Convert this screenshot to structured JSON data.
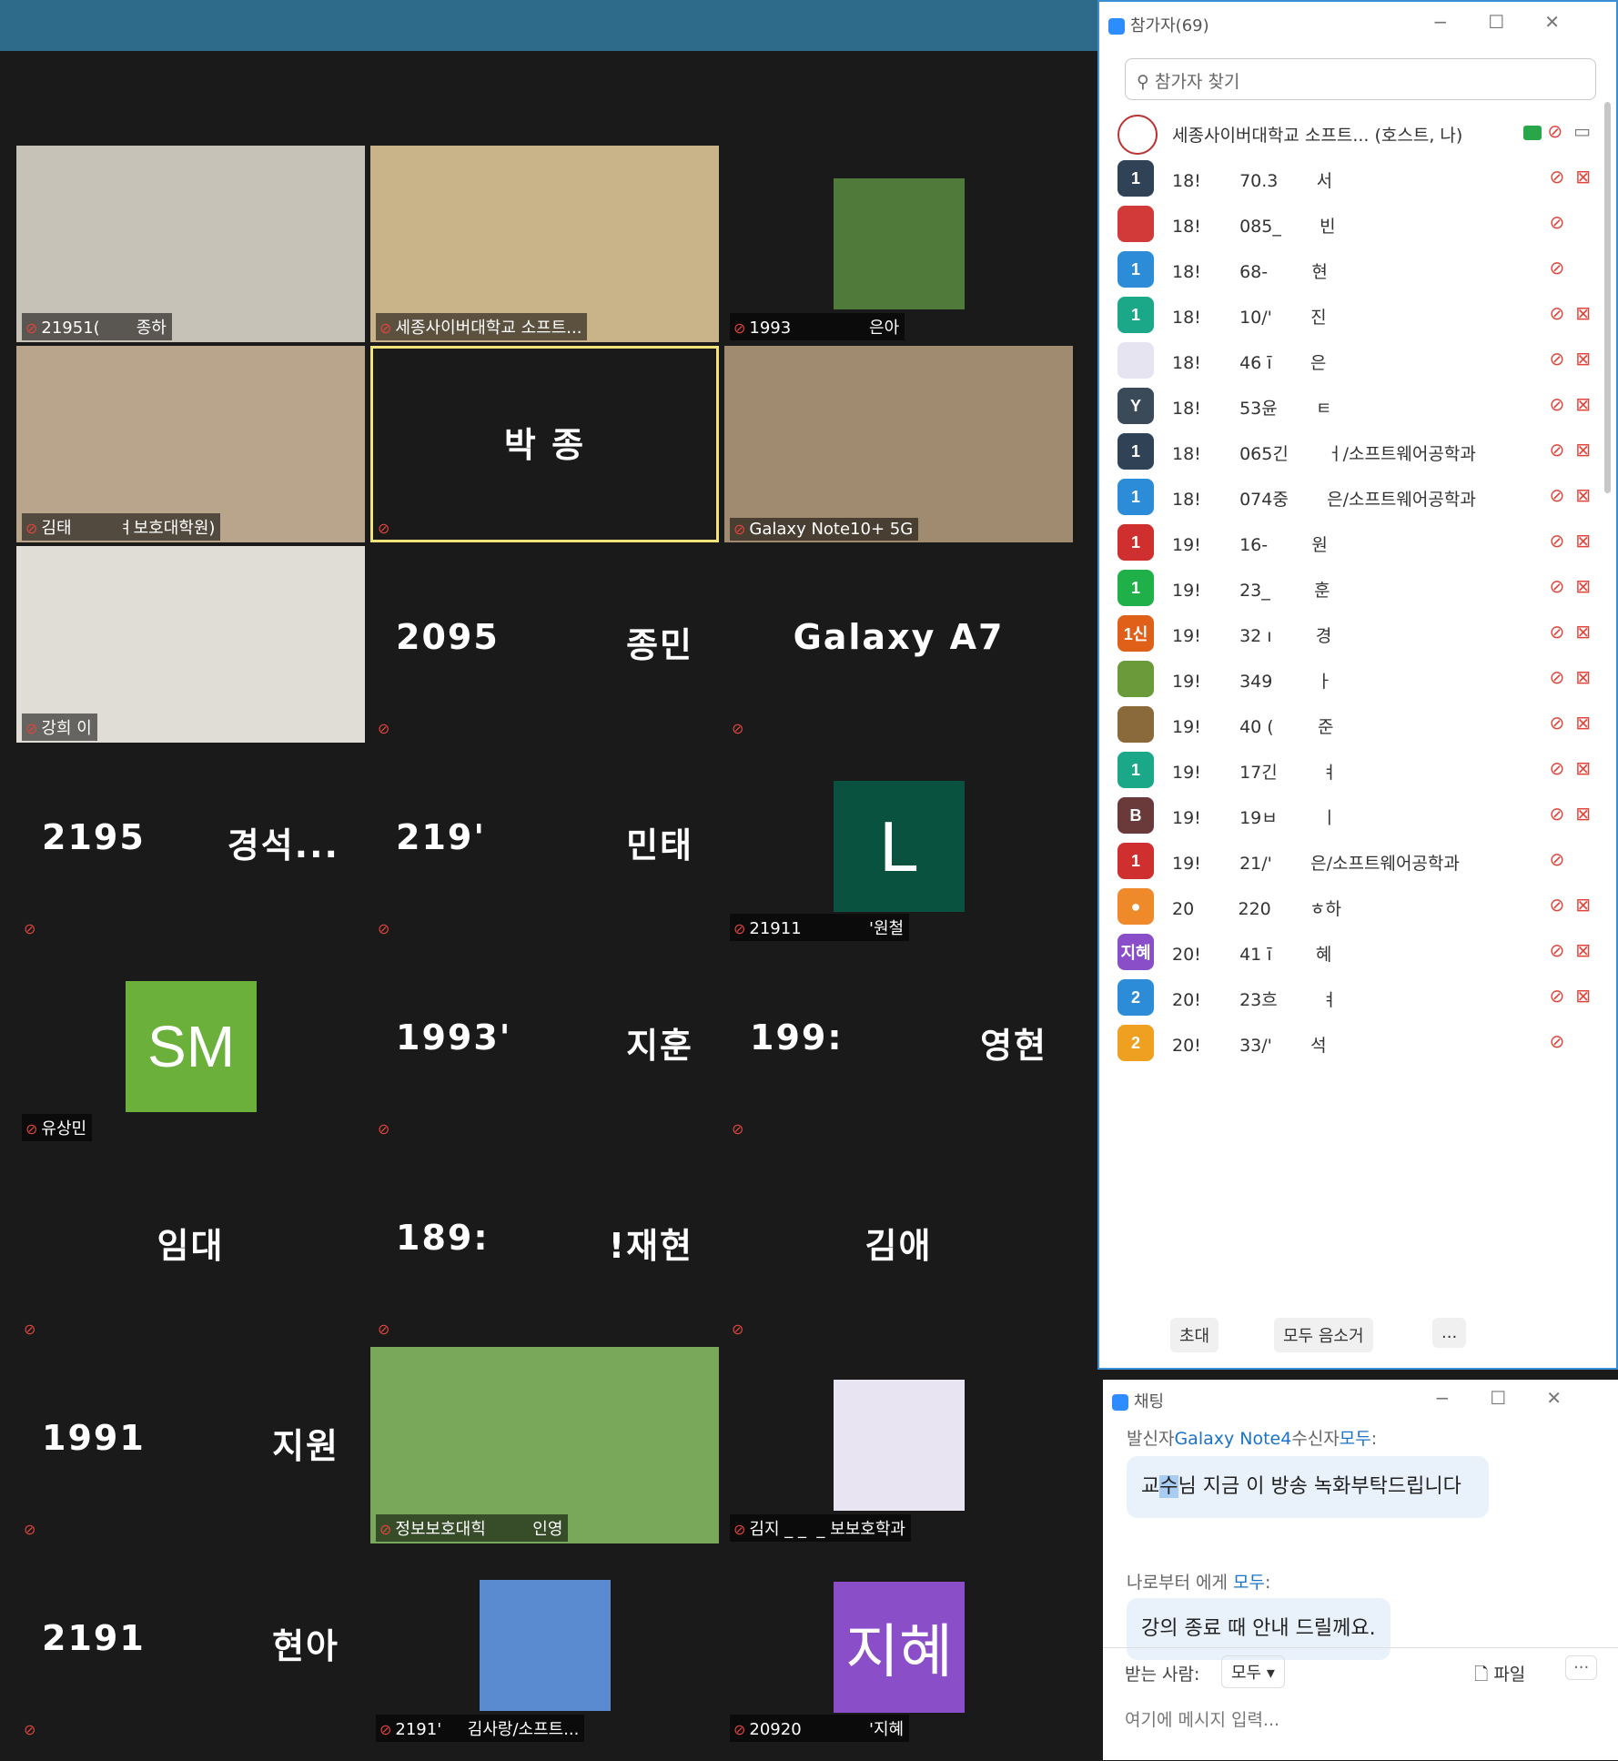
{
  "participants_window": {
    "title": "참가자(69)",
    "search_placeholder": "참가자 찾기",
    "host_row": "세종사이버대학교 소프트... (호스트, 나)",
    "rows": [
      {
        "avatar": "1",
        "avatar_color": "#2f4256",
        "text": "18!       70.3       서",
        "cam": true
      },
      {
        "avatar": "",
        "avatar_color": "#d23a3a",
        "text": "18!       085_       빈",
        "cam": false
      },
      {
        "avatar": "1",
        "avatar_color": "#2d8cd8",
        "text": "18!       68-        현",
        "cam": false
      },
      {
        "avatar": "1",
        "avatar_color": "#1ba888",
        "text": "18!       10/'       진",
        "cam": true
      },
      {
        "avatar": "",
        "avatar_color": "#e7e4f2",
        "text": "18!       46 ī       은",
        "cam": true
      },
      {
        "avatar": "Y",
        "avatar_color": "#3b4a58",
        "text": "18!       53윤       ㅌ",
        "cam": true
      },
      {
        "avatar": "1",
        "avatar_color": "#2f4256",
        "text": "18!       065긴       ㅓ/소프트웨어공학과",
        "cam": true
      },
      {
        "avatar": "1",
        "avatar_color": "#2d8cd8",
        "text": "18!       074중       은/소프트웨어공학과",
        "cam": true
      },
      {
        "avatar": "1",
        "avatar_color": "#cf2f2f",
        "text": "19!       16-        원",
        "cam": true
      },
      {
        "avatar": "1",
        "avatar_color": "#1fb04a",
        "text": "19!       23_        훈",
        "cam": true
      },
      {
        "avatar": "1신",
        "avatar_color": "#e0601a",
        "text": "19!       32 ı        경",
        "cam": true
      },
      {
        "avatar": "",
        "avatar_color": "#6a9a3a",
        "text": "19!       349        ㅏ",
        "cam": true
      },
      {
        "avatar": "",
        "avatar_color": "#8a6a3a",
        "text": "19!       40 (        준",
        "cam": true
      },
      {
        "avatar": "1",
        "avatar_color": "#1ba888",
        "text": "19!       17긴        ㅕ",
        "cam": true
      },
      {
        "avatar": "B",
        "avatar_color": "#6a3a3a",
        "text": "19!       19ㅂ        ㅣ",
        "cam": true
      },
      {
        "avatar": "1",
        "avatar_color": "#cf2f2f",
        "text": "19!       21/'       은/소프트웨어공학과",
        "cam": false
      },
      {
        "avatar": "●",
        "avatar_color": "#ef8a2a",
        "text": "20        220       ㅎ하",
        "cam": true
      },
      {
        "avatar": "지혜",
        "avatar_color": "#8a4fc8",
        "text": "20!       41 ī        혜",
        "cam": true
      },
      {
        "avatar": "2",
        "avatar_color": "#2d8cd8",
        "text": "20!       23흐        ㅕ",
        "cam": true
      },
      {
        "avatar": "2",
        "avatar_color": "#f0a020",
        "text": "20!       33/'       석",
        "cam": false
      }
    ],
    "buttons": {
      "invite": "초대",
      "mute_all": "모두 음소거",
      "more": "..."
    }
  },
  "gallery": [
    {
      "label": "21951(       종하",
      "name_left": "",
      "name_right": "",
      "type": "video",
      "bg": "#c7c2b8"
    },
    {
      "label": "세종사이버대학교 소프트...",
      "type": "video",
      "bg": "#c9b48a"
    },
    {
      "label": "1993               은아",
      "type": "image",
      "bg": "#4f7a3a"
    },
    {
      "label": "김태         ㅕ보호대학원)",
      "type": "video",
      "bg": "#b9a58c"
    },
    {
      "name": "박 종",
      "type": "name",
      "active": true
    },
    {
      "label": "Galaxy Note10+ 5G",
      "type": "video",
      "bg": "#a08a70"
    },
    {
      "label": "강희 이",
      "type": "video",
      "bg": "#e0ddd6"
    },
    {
      "name_left": "2095",
      "name_right": "종민",
      "type": "split"
    },
    {
      "name": "Galaxy A7",
      "type": "name"
    },
    {
      "name_left": "2195",
      "name_right": "경석...",
      "type": "split"
    },
    {
      "name_left": "219'",
      "name_right": "민태",
      "type": "split"
    },
    {
      "label": "21911             '원철",
      "type": "avatar",
      "avatar_text": "L",
      "avatar_bg": "#0a5240"
    },
    {
      "label": "유상민",
      "type": "avatar",
      "avatar_text": "SM",
      "avatar_bg": "#6ab03a"
    },
    {
      "name_left": "1993'",
      "name_right": "지훈",
      "type": "split"
    },
    {
      "name_left": "199:",
      "name_right": "영현",
      "type": "split"
    },
    {
      "name": "임대",
      "type": "name"
    },
    {
      "name_left": "189:",
      "name_right": "!재현",
      "type": "split"
    },
    {
      "name": "김애",
      "type": "name"
    },
    {
      "name_left": "1991",
      "name_right": "지원",
      "type": "split"
    },
    {
      "label": "정보보호대힉         인영",
      "type": "video",
      "bg": "#7aa85a"
    },
    {
      "label": "김지 _ _  _ 보보호학과",
      "type": "image",
      "bg": "#e8e4f2"
    },
    {
      "name_left": "2191",
      "name_right": "현아",
      "type": "split"
    },
    {
      "label": "2191'     김사랑/소프트...",
      "type": "image",
      "bg": "#5a8ad0"
    },
    {
      "label": "20920             '지혜",
      "type": "avatar",
      "avatar_text": "지혜",
      "avatar_bg": "#8a4fc8"
    }
  ],
  "chat": {
    "title": "채팅",
    "msg1_from_prefix": "발신자",
    "msg1_sender": "Galaxy Note4",
    "msg1_to_prefix": "수신자",
    "msg1_to": "모두",
    "msg1_text_pre": "교",
    "msg1_text_hl": "수",
    "msg1_text_post": "님 지금 이 방송 녹화부탁드립니다",
    "msg2_from": "나로부터 에게",
    "msg2_to": "모두",
    "msg2_text": "강의 종료 때 안내 드릴께요.",
    "to_label": "받는 사람:",
    "to_value": "모두",
    "file_label": "파일",
    "input_placeholder": "여기에 메시지 입력..."
  }
}
